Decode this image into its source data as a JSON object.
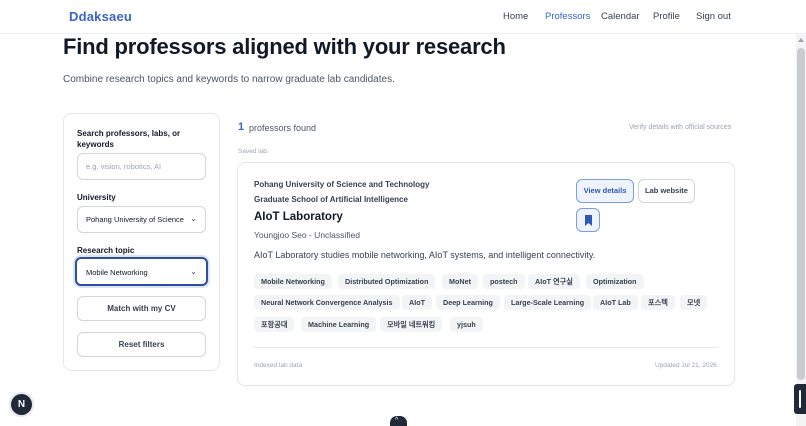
{
  "header": {
    "brand": "Ddaksaeu",
    "nav": [
      "Home",
      "Professors",
      "Calendar",
      "Profile"
    ],
    "sign_out": "Sign out",
    "active_nav": "Professors"
  },
  "hero": {
    "title": "Find professors aligned with your research",
    "subtitle": "Combine research topics and keywords to narrow graduate lab candidates."
  },
  "filters": {
    "search_label": "Search professors, labs, or keywords",
    "search_placeholder": "e.g. vision, robotics, AI",
    "search_value": "",
    "university_label": "University",
    "university_value": "Pohang University of Science",
    "topic_label": "Research topic",
    "topic_value": "Mobile Networking",
    "match_cv": "Match with my CV",
    "reset": "Reset filters"
  },
  "results": {
    "count": "1",
    "count_text": "professors found",
    "verify_note": "Verify details with official sources",
    "saved_label": "Saved lab."
  },
  "card": {
    "university": "Pohang University of Science and Technology",
    "school": "Graduate School of Artificial Intelligence",
    "lab_name": "AIoT Laboratory",
    "professor": "Youngjoo Seo - Unclassified",
    "description": "AIoT Laboratory studies mobile networking, AIoT systems, and intelligent connectivity.",
    "view_details": "View details",
    "lab_website": "Lab website",
    "tags": [
      "Mobile Networking",
      "Distributed Optimization",
      "MoNet",
      "postech",
      "AIoT 연구실",
      "Optimization",
      "Neural Network Convergence Analysis",
      "AIoT",
      "Deep Learning",
      "Large-Scale Learning",
      "AIoT Lab",
      "포스텍",
      "모넷",
      "포항공대",
      "Machine Learning",
      "모바일 네트워킹",
      "yjsuh"
    ],
    "indexed": "Indexed lab data",
    "updated": "Updated Jul 21, 2026"
  },
  "floating": {
    "dev_badge": "N",
    "scroll_top": "^"
  },
  "colors": {
    "accent": "#3b64c8",
    "focus_border": "#2d4f9e",
    "tag_bg": "#f3f4f6"
  }
}
